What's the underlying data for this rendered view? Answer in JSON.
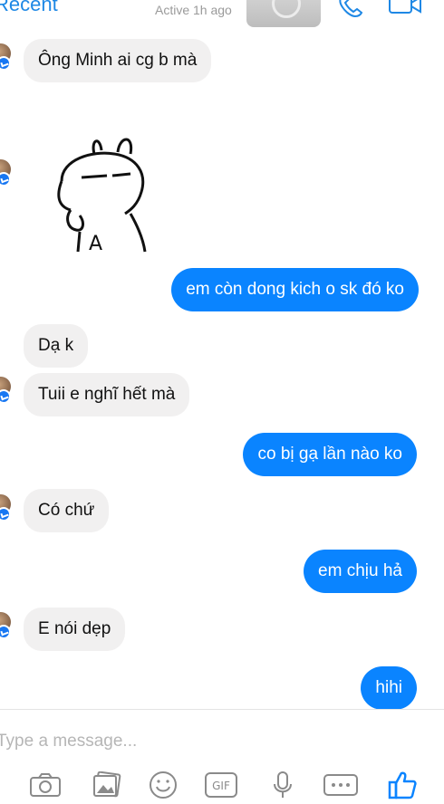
{
  "header": {
    "back_label": "Recent",
    "status": "Active 1h ago",
    "call_icon": "phone-icon",
    "video_icon": "video-camera-icon"
  },
  "messages": [
    {
      "from": "other",
      "text": "Ông Minh ai cg b mà"
    },
    {
      "from": "other",
      "type": "sticker",
      "text": "A"
    },
    {
      "from": "me",
      "text": "em còn dong kich o sk đó ko"
    },
    {
      "from": "other",
      "text": "Dạ k"
    },
    {
      "from": "other",
      "text": "Tuii e nghĩ hết mà"
    },
    {
      "from": "me",
      "text": "co bị gạ lần nào ko"
    },
    {
      "from": "other",
      "text": "Có chứ"
    },
    {
      "from": "me",
      "text": "em chịu hả"
    },
    {
      "from": "other",
      "text": "E nói dẹp"
    },
    {
      "from": "me",
      "text": "hihi"
    }
  ],
  "composer": {
    "placeholder": "Type a message...",
    "tools": [
      "camera-icon",
      "photo-gallery-icon",
      "emoji-icon",
      "gif-icon",
      "microphone-icon",
      "more-icon",
      "like-icon"
    ],
    "gif_label": "GIF"
  },
  "colors": {
    "accent": "#0a84ff",
    "incoming_bubble": "#f1f0f0",
    "badge": "#1877f2"
  }
}
